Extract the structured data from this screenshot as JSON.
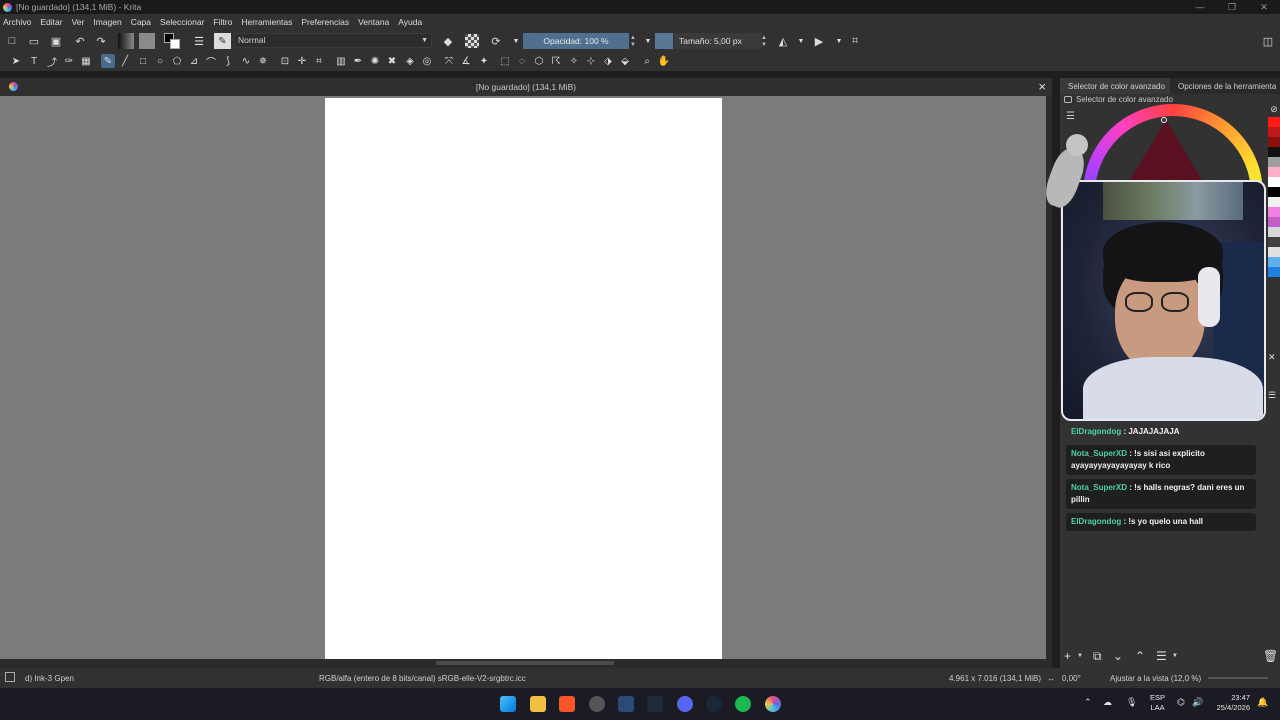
{
  "window": {
    "title": "[No guardado]  (134,1 MiB)  - Krita",
    "controls": [
      "—",
      "❐",
      "✕"
    ]
  },
  "menu": [
    "Archivo",
    "Editar",
    "Ver",
    "Imagen",
    "Capa",
    "Seleccionar",
    "Filtro",
    "Herramientas",
    "Preferencias",
    "Ventana",
    "Ayuda"
  ],
  "toolbar": {
    "blend_mode": "Normal",
    "opacity_label": "Opacidad: 100 %",
    "size_label": "Tamaño: 5,00 px"
  },
  "document": {
    "tab_title": "[No guardado]  (134,1 MiB)"
  },
  "docker": {
    "tabs": [
      "Selector de color avanzado",
      "Opciones de la herramienta"
    ],
    "title": "Selector de color avanzado",
    "palette": [
      "#ff1a1a",
      "#c01818",
      "#881010",
      "#111111",
      "#9e9e9e",
      "#ffb0c8",
      "#ffffff",
      "#000000",
      "#f0f0f0",
      "#f080e0",
      "#c060c8",
      "#d8d8d8",
      "#404040",
      "#e0e0e0",
      "#60b0f0",
      "#2080e0"
    ]
  },
  "chat": [
    {
      "user": "ElDragondog",
      "text": ": JAJAJAJAJA"
    },
    {
      "user": "Nota_SuperXD",
      "text": ": !s sisi asi explicito ayayayyayayayayay k rico"
    },
    {
      "user": "Nota_SuperXD",
      "text": ": !s halls negras? dani eres un pillin"
    },
    {
      "user": "ElDragondog",
      "text": ": !s yo quelo una hall"
    }
  ],
  "status": {
    "brush": "d) Ink-3 Gpen",
    "colorspace": "RGB/alfa (entero de 8 bits/canal)  sRGB-elle-V2-srgbtrc.icc",
    "dimensions": "4.961 x 7.016 (134,1 MiB)",
    "rotation": "0,00°",
    "zoom": "Ajustar a la vista (12,0 %)"
  },
  "taskbar": {
    "lang_line1": "ESP",
    "lang_line2": "LAA",
    "time": "23:47",
    "date": "25/4/2026"
  }
}
